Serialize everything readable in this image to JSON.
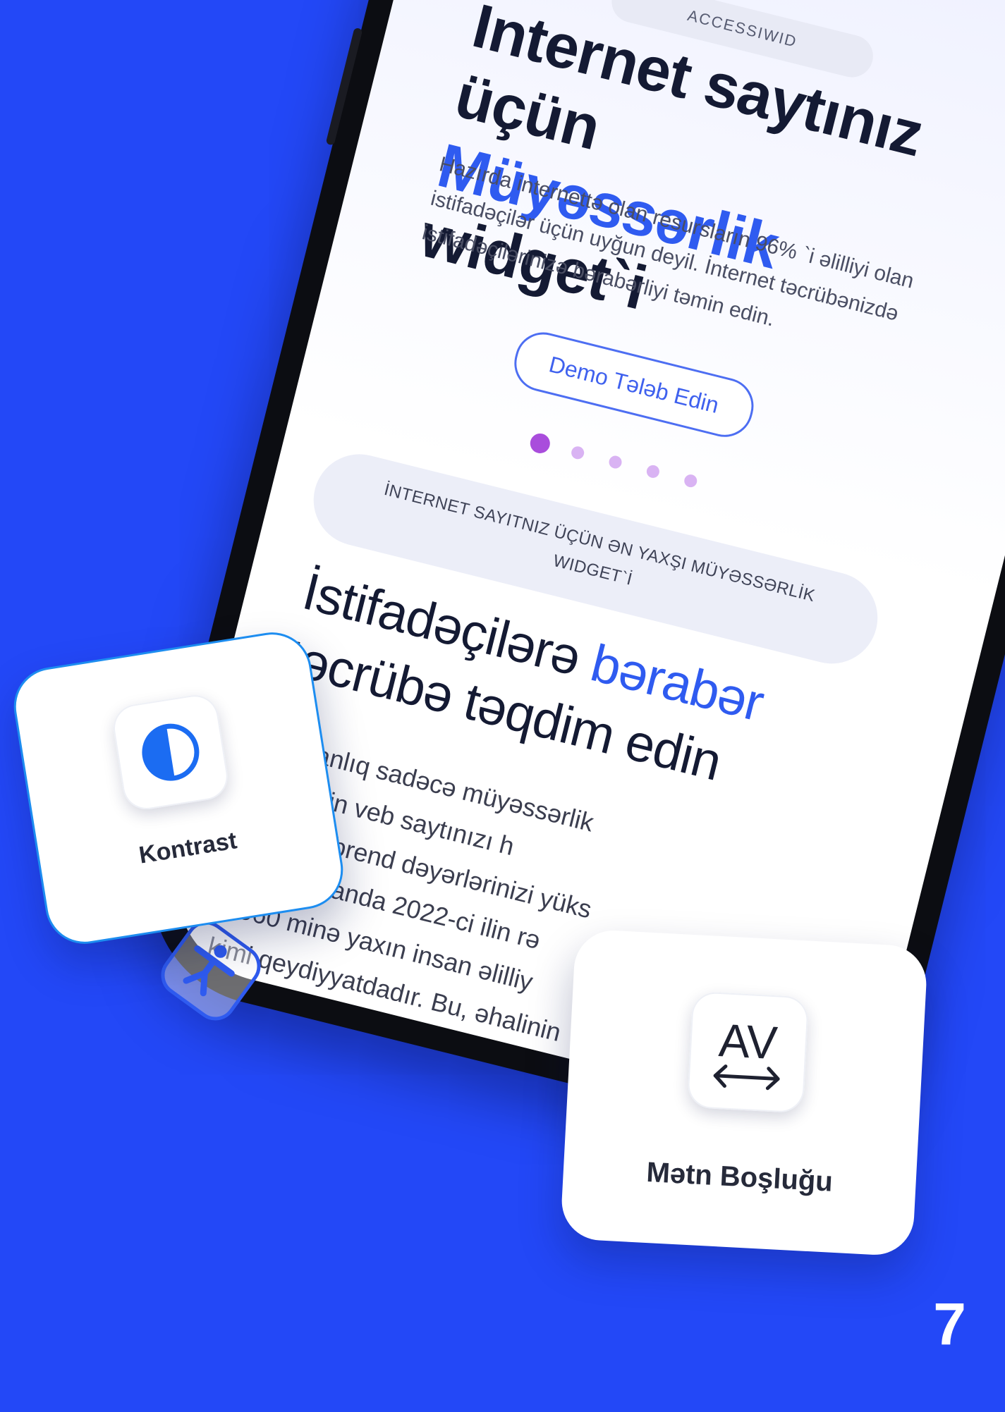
{
  "phone": {
    "top_pill": "ACCESSIWID",
    "hero": {
      "line1": "Internet saytınız üçün",
      "accent": "Müyəssərlik",
      "line2_rest": " widget`i"
    },
    "lead": "Hazırda internettə olan resursların 96% `i əlilliyi olan istifadəçilər üçün uyğun deyil. İnternet təcrübənizdə istifadəçilərinizə bərabərliyi təmin edin.",
    "demo_button": "Demo Tələb Edin",
    "carousel": {
      "total": 5,
      "active_index": 0
    },
    "section_badge_line1": "İNTERNET SAYITNIZ ÜÇÜN ƏN YAXŞI MÜYƏSSƏRLİK",
    "section_badge_line2": "WIDGET`İ",
    "section_title": {
      "part1": "İstifadəçilərə ",
      "accent": "bərabər",
      "part2": "təcrübə təqdim edin"
    },
    "body_lines": [
      "Əlçatanlıq sadəcə müyəssərlik",
      "həmçinin veb saytınızı h",
      "etməklə brend dəyərlərinizi yüks",
      "Azərbaycanda 2022-ci ilin rə",
      "ə 560 minə yaxın insan əlilliy",
      "kimi qeydiyyatdadır. Bu, əhalinin"
    ]
  },
  "cards": {
    "contrast": {
      "label": "Kontrast",
      "icon": "contrast-icon"
    },
    "spacing": {
      "label": "Mətn Boşluğu",
      "icon": "text-spacing-icon",
      "icon_text": "AV"
    }
  },
  "accessibility_button_icon": "accessibility-icon",
  "page_number": "7",
  "colors": {
    "background": "#2348f7",
    "accent": "#2f5bf0",
    "dot_active": "#a94ddc",
    "dot_inactive": "#d9b3f3"
  }
}
